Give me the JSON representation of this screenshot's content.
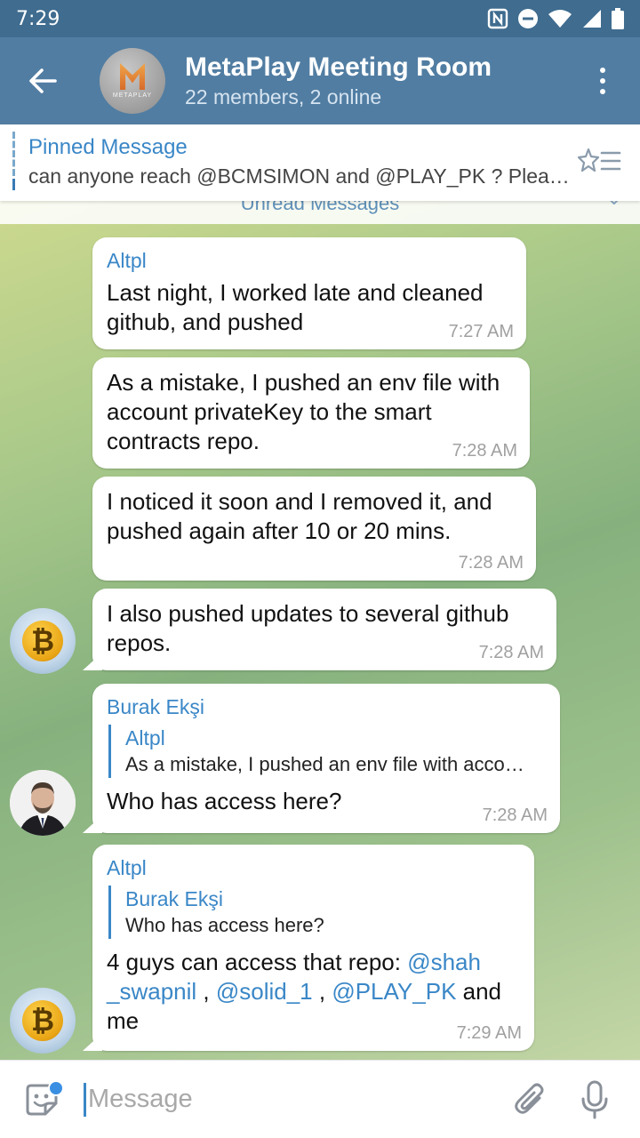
{
  "status_bar": {
    "time": "7:29"
  },
  "header": {
    "title": "MetaPlay Meeting Room",
    "subtitle": "22 members, 2 online",
    "avatar_logo_text": "METAPLAY"
  },
  "pinned": {
    "title": "Pinned Message",
    "text": "can anyone reach @BCMSIMON  and @PLAY_PK ? Please make sure they are notified"
  },
  "unread_label": "Unread Messages",
  "messages": [
    {
      "sender": "Altpl",
      "text": "Last night, I worked late and cleaned github, and pushed",
      "time": "7:27 AM"
    },
    {
      "text": "As a mistake, I pushed an env file with account privateKey to the smart contracts repo.",
      "time": "7:28 AM"
    },
    {
      "text": "I noticed it soon and I removed it, and pushed again after 10 or 20 mins.",
      "time": "7:28 AM"
    },
    {
      "text": "I also pushed updates to several github repos.",
      "time": "7:28 AM"
    },
    {
      "sender": "Burak Ekşi",
      "reply_sender": "Altpl",
      "reply_text": "As a mistake, I pushed an env file with account privateKey to the smart contracts repo.",
      "text": "Who has access here?",
      "time": "7:28 AM"
    },
    {
      "sender": "Altpl",
      "reply_sender": "Burak Ekşi",
      "reply_text": "Who has access here?",
      "text_start": "4 guys can access that repo: ",
      "mention1": "@shah _swapnil",
      "sep1": " , ",
      "mention2": "@solid_1",
      "sep2": " , ",
      "mention3": "@PLAY_PK",
      "text_end": "  and me",
      "time": "7:29 AM"
    }
  ],
  "input": {
    "placeholder": "Message"
  },
  "colors": {
    "header": "#517da2",
    "status_bar": "#3f6c8f",
    "accent": "#3a87c7"
  }
}
